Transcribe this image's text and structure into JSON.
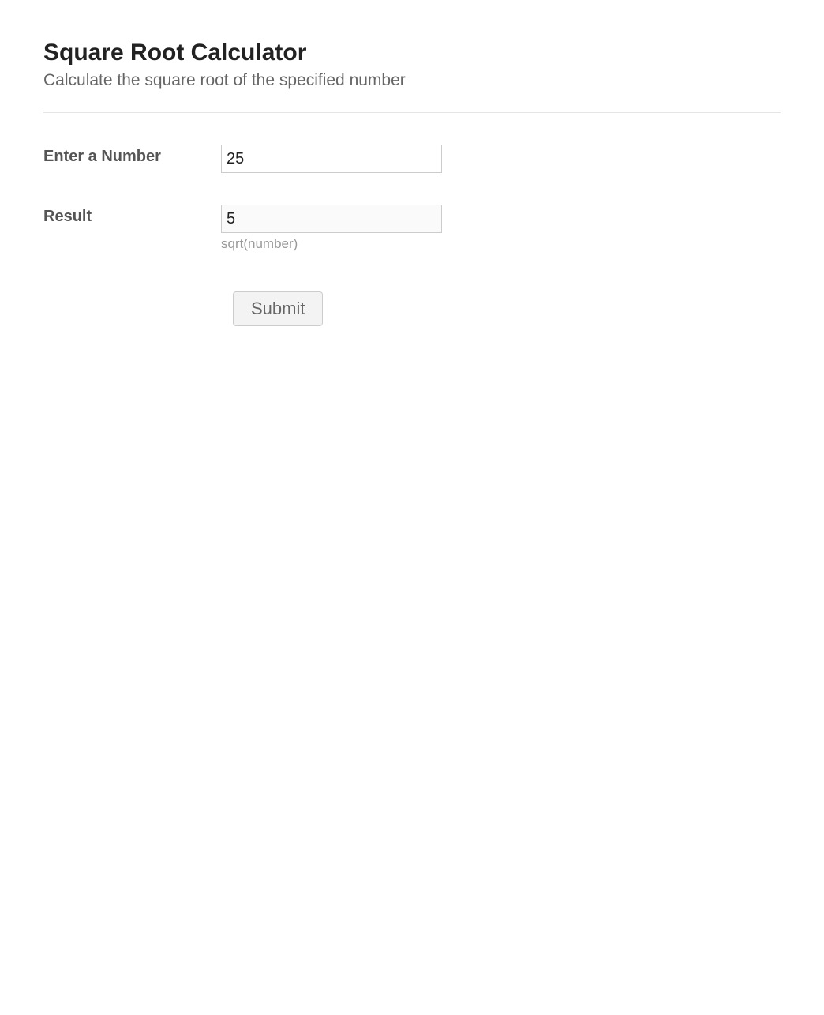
{
  "header": {
    "title": "Square Root Calculator",
    "subtitle": "Calculate the square root of the specified number"
  },
  "form": {
    "number_label": "Enter a Number",
    "number_value": "25",
    "result_label": "Result",
    "result_value": "5",
    "result_help": "sqrt(number)",
    "submit_label": "Submit"
  }
}
